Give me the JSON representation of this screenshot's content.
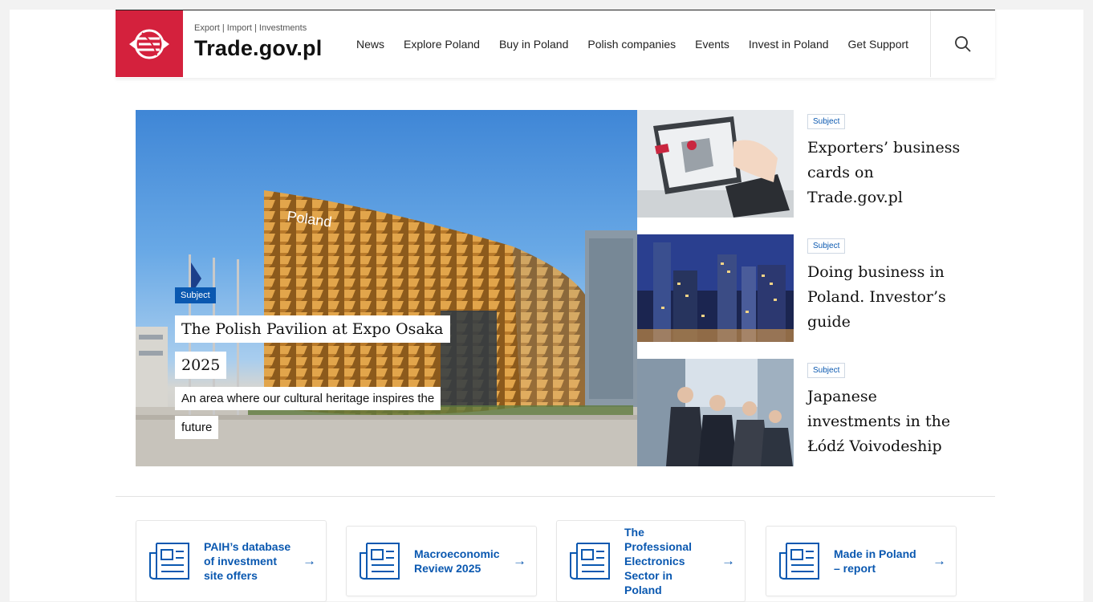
{
  "brand": {
    "tagline": "Export | Import | Investments",
    "name": "Trade.gov.pl",
    "color": "#d4213d"
  },
  "nav": {
    "items": [
      "News",
      "Explore Poland",
      "Buy in Poland",
      "Polish companies",
      "Events",
      "Invest in Poland",
      "Get Support"
    ],
    "search_icon": "search-icon"
  },
  "hero": {
    "tag": "Subject",
    "title": "The Polish Pavilion at Expo Osaka 2025",
    "subtitle": "An area where our cultural heritage inspires the future",
    "image_sign": "Poland"
  },
  "side_cards": [
    {
      "tag": "Subject",
      "title": "Exporters’ business cards on Trade.gov.pl"
    },
    {
      "tag": "Subject",
      "title": "Doing business in Poland. Investor’s guide"
    },
    {
      "tag": "Subject",
      "title": "Japanese investments in the Łódź Voivodeship"
    }
  ],
  "tiles": [
    {
      "label": "PAIH’s database of investment site offers",
      "icon": "newspaper-icon",
      "arrow": "→"
    },
    {
      "label": "Macroeconomic Review 2025",
      "icon": "newspaper-icon",
      "arrow": "→"
    },
    {
      "label": "The Professional Electronics Sector in Poland",
      "icon": "newspaper-icon",
      "arrow": "→"
    },
    {
      "label": "Made in Poland – report",
      "icon": "newspaper-icon",
      "arrow": "→"
    }
  ],
  "colors": {
    "accent_blue": "#0a58b0",
    "brand_red": "#d4213d"
  }
}
